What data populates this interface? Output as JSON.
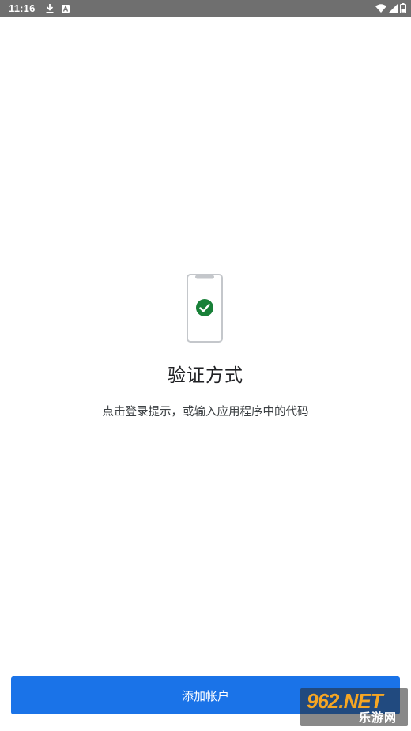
{
  "status_bar": {
    "time": "11:16",
    "left_icons": [
      "download-icon",
      "a-icon"
    ],
    "right_icons": [
      "wifi-icon",
      "signal-icon",
      "battery-icon"
    ]
  },
  "illustration": {
    "icon": "phone-check-icon",
    "check_color": "#188038"
  },
  "main": {
    "title": "验证方式",
    "subtitle": "点击登录提示，或输入应用程序中的代码"
  },
  "actions": {
    "add_account_label": "添加帐户"
  },
  "watermark": {
    "logo_text": "962.NET",
    "site_text": "乐游网"
  },
  "colors": {
    "primary": "#1a73e8",
    "status_bar": "#6f6f6f",
    "check": "#188038"
  }
}
